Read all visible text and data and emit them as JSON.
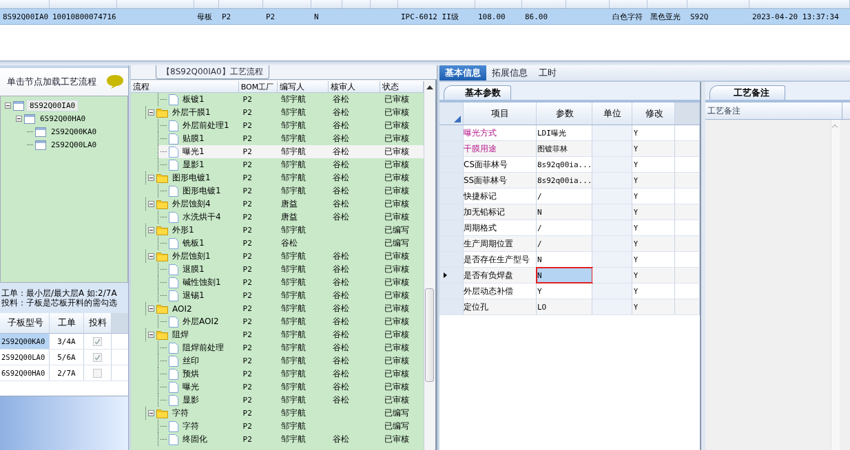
{
  "top_grid": {
    "rows": [
      {
        "selected": true,
        "cells": [
          "8S92Q00IA0",
          "10010800074716",
          null,
          "母板",
          "P2",
          "P2",
          "N",
          null,
          null,
          "IPC-6012 II级",
          "108.00",
          "86.00",
          null,
          "白色字符",
          "黑色亚光",
          "S92Q",
          "2023-04-20 13:37:34"
        ]
      }
    ]
  },
  "left_panel": {
    "title": "单击节点加载工艺流程",
    "tree": [
      {
        "label": "8S92Q00IA0",
        "selected": true,
        "children": [
          {
            "label": "6S92Q00HA0",
            "selected": false,
            "children": [
              {
                "label": "2S92Q00KA0",
                "selected": false
              },
              {
                "label": "2S92Q00LA0",
                "selected": false
              }
            ]
          }
        ]
      }
    ],
    "notes": [
      "工单：最小层/最大层A 如:2/7A",
      "投料：子板是芯板开料的需勾选"
    ],
    "columns": [
      "子板型号",
      "工单",
      "投料"
    ],
    "rows": [
      {
        "model": "2S92Q00KA0",
        "order": "3/4A",
        "checked": true,
        "selected": true
      },
      {
        "model": "2S92Q00LA0",
        "order": "5/6A",
        "checked": true,
        "selected": false
      },
      {
        "model": "6S92Q00HA0",
        "order": "2/7A",
        "checked": false,
        "selected": false
      }
    ]
  },
  "flow_panel": {
    "title": "【8S92Q00IA0】工艺流程",
    "columns": [
      "流程",
      "BOM工厂",
      "编写人",
      "核审人",
      "状态"
    ],
    "tree": [
      {
        "children": [
          {
            "name": "板镀1",
            "bom": "P2",
            "author": "邹宇航",
            "reviewer": "谷松",
            "status": "已审核",
            "selected": false
          }
        ]
      },
      {
        "name": "外层干膜1",
        "bom": "P2",
        "author": "邹宇航",
        "reviewer": "谷松",
        "status": "已审核",
        "selected": false,
        "children": [
          {
            "name": "外层前处理1",
            "bom": "P2",
            "author": "邹宇航",
            "reviewer": "谷松",
            "status": "已审核",
            "selected": false
          },
          {
            "name": "贴膜1",
            "bom": "P2",
            "author": "邹宇航",
            "reviewer": "谷松",
            "status": "已审核",
            "selected": false
          },
          {
            "name": "曝光1",
            "bom": "P2",
            "author": "邹宇航",
            "reviewer": "谷松",
            "status": "已审核",
            "selected": true
          },
          {
            "name": "显影1",
            "bom": "P2",
            "author": "邹宇航",
            "reviewer": "谷松",
            "status": "已审核",
            "selected": false
          }
        ]
      },
      {
        "name": "图形电镀1",
        "bom": "P2",
        "author": "邹宇航",
        "reviewer": "谷松",
        "status": "已审核",
        "selected": false,
        "children": [
          {
            "name": "图形电镀1",
            "bom": "P2",
            "author": "邹宇航",
            "reviewer": "谷松",
            "status": "已审核",
            "selected": false
          }
        ]
      },
      {
        "name": "外层蚀刻4",
        "bom": "P2",
        "author": "唐益",
        "reviewer": "谷松",
        "status": "已审核",
        "selected": false,
        "children": [
          {
            "name": "水洗烘干4",
            "bom": "P2",
            "author": "唐益",
            "reviewer": "谷松",
            "status": "已审核",
            "selected": false
          }
        ]
      },
      {
        "name": "外形1",
        "bom": "P2",
        "author": "邹宇航",
        "status": "已编写",
        "selected": false,
        "children": [
          {
            "name": "铣板1",
            "bom": "P2",
            "author": "谷松",
            "status": "已编写",
            "selected": false
          }
        ]
      },
      {
        "name": "外层蚀刻1",
        "bom": "P2",
        "author": "邹宇航",
        "reviewer": "谷松",
        "status": "已审核",
        "selected": false,
        "children": [
          {
            "name": "退膜1",
            "bom": "P2",
            "author": "邹宇航",
            "reviewer": "谷松",
            "status": "已审核",
            "selected": false
          },
          {
            "name": "碱性蚀刻1",
            "bom": "P2",
            "author": "邹宇航",
            "reviewer": "谷松",
            "status": "已审核",
            "selected": false
          },
          {
            "name": "退锡1",
            "bom": "P2",
            "author": "邹宇航",
            "reviewer": "谷松",
            "status": "已审核",
            "selected": false
          }
        ]
      },
      {
        "name": "AOI2",
        "bom": "P2",
        "author": "邹宇航",
        "reviewer": "谷松",
        "status": "已审核",
        "selected": false,
        "children": [
          {
            "name": "外层AOI2",
            "bom": "P2",
            "author": "邹宇航",
            "reviewer": "谷松",
            "status": "已审核",
            "selected": false
          }
        ]
      },
      {
        "name": "阻焊",
        "bom": "P2",
        "author": "邹宇航",
        "reviewer": "谷松",
        "status": "已审核",
        "selected": false,
        "children": [
          {
            "name": "阻焊前处理",
            "bom": "P2",
            "author": "邹宇航",
            "reviewer": "谷松",
            "status": "已审核",
            "selected": false
          },
          {
            "name": "丝印",
            "bom": "P2",
            "author": "邹宇航",
            "reviewer": "谷松",
            "status": "已审核",
            "selected": false
          },
          {
            "name": "预烘",
            "bom": "P2",
            "author": "邹宇航",
            "reviewer": "谷松",
            "status": "已审核",
            "selected": false
          },
          {
            "name": "曝光",
            "bom": "P2",
            "author": "邹宇航",
            "reviewer": "谷松",
            "status": "已审核",
            "selected": false
          },
          {
            "name": "显影",
            "bom": "P2",
            "author": "邹宇航",
            "reviewer": "谷松",
            "status": "已审核",
            "selected": false
          }
        ]
      },
      {
        "name": "字符",
        "bom": "P2",
        "author": "邹宇航",
        "status": "已编写",
        "selected": false,
        "children": [
          {
            "name": "字符",
            "bom": "P2",
            "author": "邹宇航",
            "status": "已编写",
            "selected": false
          },
          {
            "name": "终固化",
            "bom": "P2",
            "author": "邹宇航",
            "reviewer": "谷松",
            "status": "已审核",
            "selected": false
          }
        ]
      }
    ]
  },
  "detail_panel": {
    "tabs": [
      {
        "label": "基本信息",
        "selected": true
      },
      {
        "label": "拓展信息",
        "selected": false
      },
      {
        "label": "工时",
        "selected": false
      }
    ],
    "params": {
      "tab": "基本参数",
      "columns": [
        "项目",
        "参数",
        "单位",
        "修改"
      ],
      "rows": [
        {
          "item": "曝光方式",
          "emphasized": true,
          "value": "LDI曝光",
          "modify": "Y",
          "selected": false
        },
        {
          "item": "干膜用途",
          "emphasized": true,
          "value": "图镀菲林",
          "modify": "Y",
          "selected": false
        },
        {
          "item": "CS面菲林号",
          "emphasized": false,
          "value": "8s92q00ia...",
          "modify": "Y",
          "selected": false
        },
        {
          "item": "SS面菲林号",
          "emphasized": false,
          "value": "8s92q00ia...",
          "modify": "Y",
          "selected": false
        },
        {
          "item": "快捷标记",
          "emphasized": false,
          "value": "/",
          "modify": "Y",
          "selected": false
        },
        {
          "item": "加无铅标记",
          "emphasized": false,
          "value": "N",
          "modify": "Y",
          "selected": false
        },
        {
          "item": "周期格式",
          "emphasized": false,
          "value": "/",
          "modify": "Y",
          "selected": false
        },
        {
          "item": "生产周期位置",
          "emphasized": false,
          "value": "/",
          "modify": "Y",
          "selected": false
        },
        {
          "item": "是否存在生产型号",
          "emphasized": false,
          "value": "N",
          "modify": "Y",
          "selected": false
        },
        {
          "item": "是否有负焊盘",
          "emphasized": false,
          "value": "N",
          "modify": "Y",
          "selected": true
        },
        {
          "item": "外层动态补偿",
          "emphasized": false,
          "value": "Y",
          "modify": "Y",
          "selected": false
        },
        {
          "item": "定位孔",
          "emphasized": false,
          "value": "LO",
          "modify": "Y",
          "selected": false
        }
      ]
    },
    "remarks": {
      "tab": "工艺备注",
      "column": "工艺备注"
    }
  }
}
